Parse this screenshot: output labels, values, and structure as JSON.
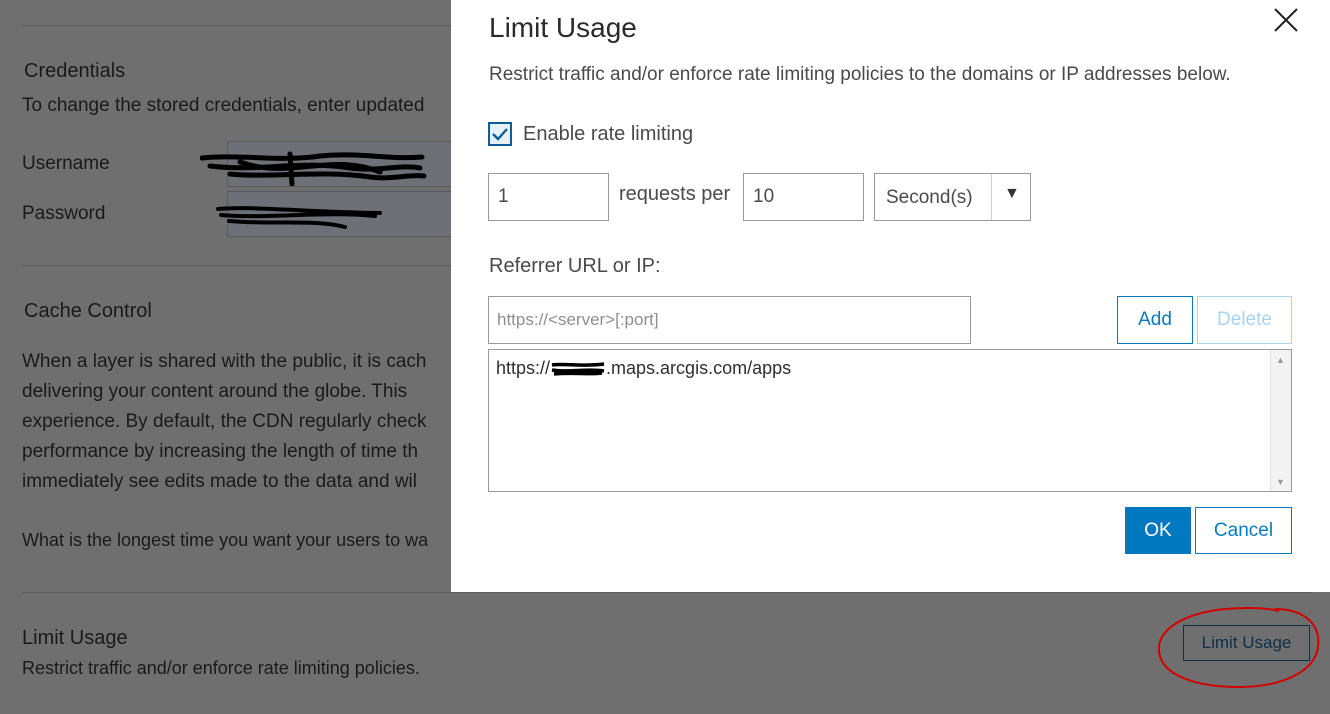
{
  "background": {
    "credentials": {
      "heading": "Credentials",
      "desc": "To change the stored credentials, enter updated",
      "username_label": "Username",
      "password_label": "Password"
    },
    "cache_control": {
      "heading": "Cache Control",
      "lines": [
        "When a layer is shared with the public, it is cach",
        "delivering your content around the globe. This",
        "experience. By default, the CDN regularly check",
        "performance by increasing the length of time th",
        "immediately see edits made to the data and wil"
      ],
      "question": "What is the longest time you want your users to wa"
    },
    "limit_usage": {
      "heading": "Limit Usage",
      "desc": "Restrict traffic and/or enforce rate limiting policies.",
      "button_label": "Limit Usage"
    },
    "annotation_color": "#d40000"
  },
  "modal": {
    "title": "Limit Usage",
    "description": "Restrict traffic and/or enforce rate limiting policies to the domains or IP addresses below.",
    "enable_rate_limiting": {
      "label": "Enable rate limiting",
      "checked": true
    },
    "requests_value": "1",
    "requests_per_label": "requests per",
    "interval_value": "10",
    "unit_selected": "Second(s)",
    "referrer_label": "Referrer URL or IP:",
    "referrer_placeholder": "https://<server>[:port]",
    "add_label": "Add",
    "delete_label": "Delete",
    "referrers": [
      {
        "prefix": "https://",
        "suffix": ".maps.arcgis.com/apps"
      }
    ],
    "ok_label": "OK",
    "cancel_label": "Cancel"
  },
  "icons": [
    "close-icon",
    "checkmark-icon",
    "chevron-down-icon",
    "scroll-up-icon",
    "scroll-down-icon"
  ],
  "colors": {
    "accent": "#0079c1",
    "overlay": "#6f6f6f",
    "disabled": "#a9d3ee"
  }
}
